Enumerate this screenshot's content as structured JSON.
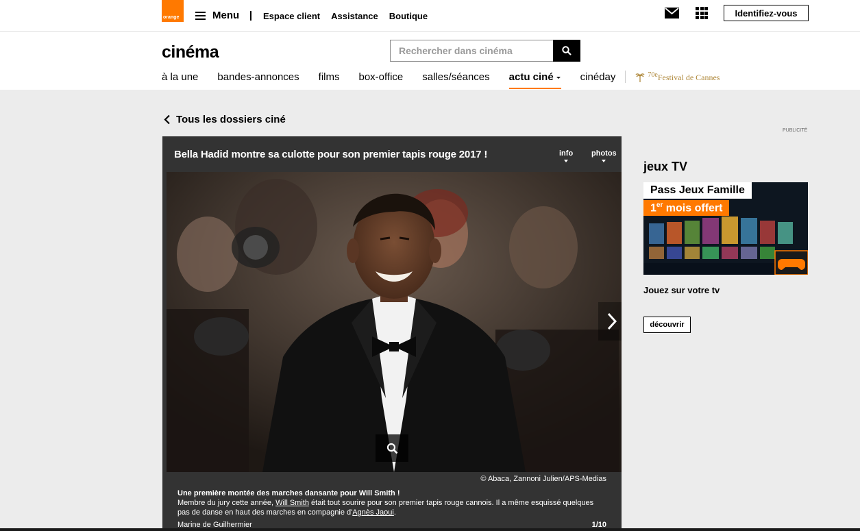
{
  "topbar": {
    "logo_text": "orange",
    "menu_label": "Menu",
    "links": [
      "Espace client",
      "Assistance",
      "Boutique"
    ],
    "login_label": "Identifiez-vous"
  },
  "header": {
    "site_title": "cinéma",
    "search_placeholder": "Rechercher dans cinéma",
    "nav": [
      "à la une",
      "bandes-annonces",
      "films",
      "box-office",
      "salles/séances",
      "actu ciné",
      "cinéday"
    ],
    "active_nav": "actu ciné",
    "cannes_number": "70",
    "cannes_suffix": "e",
    "cannes_label": "Festival de Cannes"
  },
  "page": {
    "back_label": "Tous les dossiers ciné",
    "pub_label": "PUBLICITÉ"
  },
  "slideshow": {
    "title": "Bella Hadid montre sa culotte pour son premier tapis rouge 2017 !",
    "tab_info": "info",
    "tab_photos": "photos",
    "credit": "© Abaca, Zannoni Julien/APS-Medias",
    "caption_heading": "Une première montée des marches dansante pour Will Smith !",
    "caption_part1": "Membre du jury cette année, ",
    "caption_link1": "Will Smith",
    "caption_part2": " était tout sourire pour son premier tapis rouge cannois. Il a même esquissé quelques pas de danse en haut des marches en compagnie d'",
    "caption_link2": "Agnès Jaoui",
    "caption_part3": ".",
    "author": "Marine de Guilhermier",
    "counter": "1/10"
  },
  "sidebar": {
    "ad_title": "jeux TV",
    "ad_banner_line1": "Pass Jeux Famille",
    "ad_banner_line2_sup": "er",
    "ad_banner_line2_num": "1",
    "ad_banner_line2": " mois offert",
    "ad_text": "Jouez sur votre tv",
    "ad_button": "découvrir"
  },
  "colors": {
    "brand_orange": "#ff7900",
    "slideshow_bg": "#333333",
    "page_bg": "#ececec"
  }
}
